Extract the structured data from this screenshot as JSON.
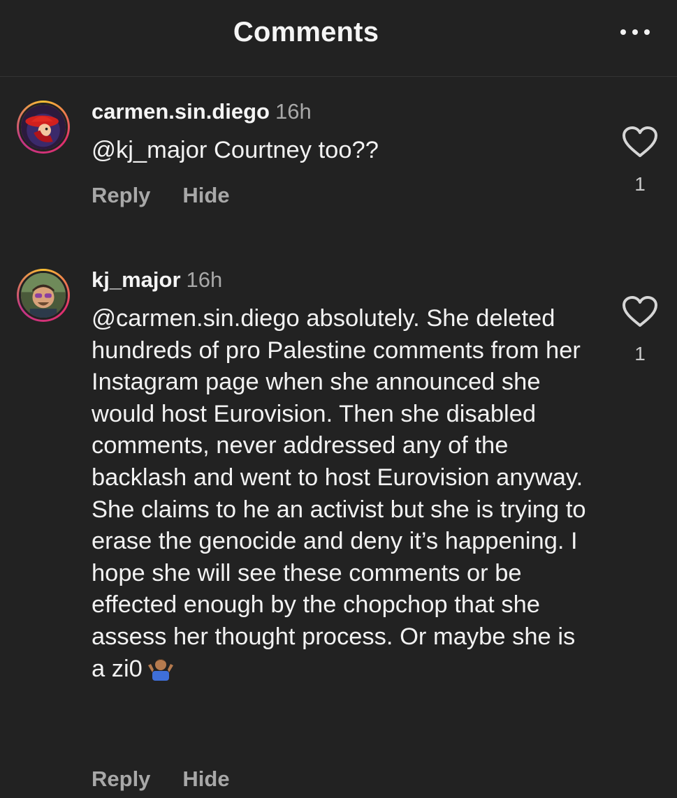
{
  "header": {
    "title": "Comments",
    "more_icon": "more-horizontal-icon"
  },
  "comments": [
    {
      "username": "carmen.sin.diego",
      "time": "16h",
      "mention": "@kj_major",
      "text": " Courtney too??",
      "reply_label": "Reply",
      "hide_label": "Hide",
      "likes": "1"
    },
    {
      "username": "kj_major",
      "time": "16h",
      "mention": "@carmen.sin.diego",
      "text": " absolutely. She deleted hundreds of pro Palestine comments from her Instagram page when she announced she would host Eurovision. Then she disabled comments, never addressed any of the backlash and went to host Eurovision anyway. She claims to he an activist but she is trying to erase the genocide and deny it’s happening. I hope she will see these comments or be effected enough by the chopchop that she assess her thought process. Or maybe she is a zi0",
      "emoji": "person-shrugging-icon",
      "reply_label": "Reply",
      "hide_label": "Hide",
      "likes": "1"
    }
  ],
  "colors": {
    "background": "#222222",
    "text": "#f2f2f2",
    "secondary": "#a8a8a8",
    "story_ring": [
      "#f9c033",
      "#e1306c",
      "#c13584"
    ]
  }
}
